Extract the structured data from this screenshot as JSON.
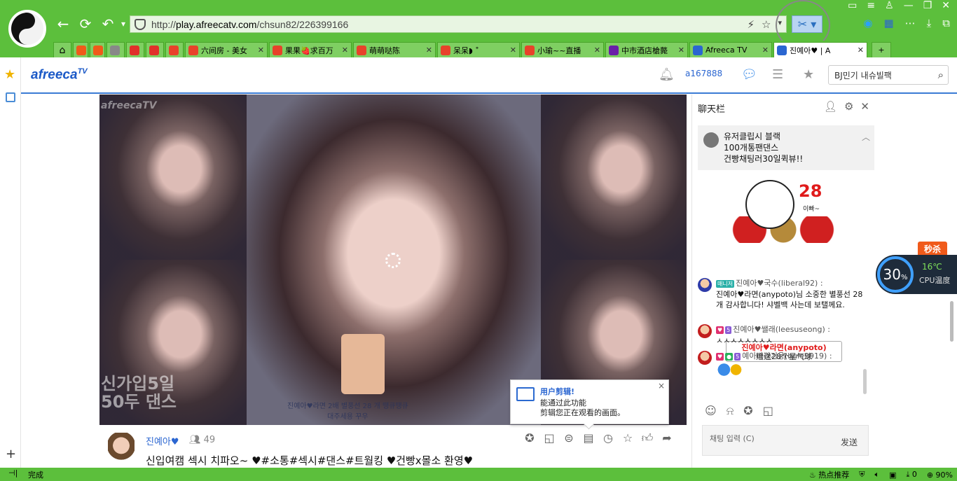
{
  "browser": {
    "url_prefix": "http://",
    "url_host": "play.afreecatv.com",
    "url_path": "/chsun82/226399166",
    "tabs": [
      {
        "label": "",
        "fav_color": "#f05a1a",
        "fav_icon": "taobao-icon"
      },
      {
        "label": "",
        "fav_color": "#f05a1a",
        "fav_icon": "taobao-icon"
      },
      {
        "label": "",
        "fav_color": "#888888",
        "fav_icon": "gear-icon"
      },
      {
        "label": "",
        "fav_color": "#e0302a",
        "fav_icon": "weibo-icon"
      },
      {
        "label": "",
        "fav_color": "#e0302a",
        "fav_icon": "weibo-icon"
      },
      {
        "label": "",
        "fav_color": "#e8422a",
        "fav_icon": "six-icon"
      },
      {
        "label": "六间房 - 美女",
        "fav_color": "#e8422a",
        "fav_icon": "six-icon"
      },
      {
        "label": "果果🍓求百万",
        "fav_color": "#e8422a",
        "fav_icon": "six-icon"
      },
      {
        "label": "萌萌哒陈",
        "fav_color": "#e8422a",
        "fav_icon": "six-icon"
      },
      {
        "label": "呆呆◗ ˚",
        "fav_color": "#e8422a",
        "fav_icon": "six-icon"
      },
      {
        "label": "小瑜~~直播",
        "fav_color": "#e8422a",
        "fav_icon": "six-icon"
      },
      {
        "label": "中市酒店槍斃",
        "fav_color": "#6a1fa8",
        "fav_icon": "yahoo-icon"
      },
      {
        "label": "Afreeca TV",
        "fav_color": "#2b66d1",
        "fav_icon": "afreeca-icon"
      },
      {
        "label": "진예아♥ | A",
        "fav_color": "#2b66d1",
        "fav_icon": "afreeca-icon",
        "active": true
      }
    ]
  },
  "header": {
    "brand": "afreeca",
    "brand_sup": "TV",
    "user_id": "a167888",
    "search_value": "BJ민기 내슈빌팩"
  },
  "video": {
    "logo": "afreecaTV",
    "overlay_line1": "신가입5일",
    "overlay_line2": "50두 댄스",
    "caption_line1": "진예아♥라면 2배 별풍선 28 개 땡큐땡큐",
    "caption_line2": "대주세용 꾸우"
  },
  "popup": {
    "title": "用户剪辑!",
    "line1": "能通过此功能",
    "line2": "剪辑您正在观看的画面。",
    "close": "×"
  },
  "broadcast": {
    "bj_name": "진예아♥",
    "viewers": "49",
    "title": "신입여캠 섹시 치파오~ ♥#소통#섹시#댄스#트월킹 ♥건빵x몰소 환영♥"
  },
  "chat": {
    "title": "聊天栏",
    "notice_lines": [
      "유저클립시 블랙",
      "100개통팬댄스",
      "건빵채팅러30일퀵뷰!!"
    ],
    "gift_count": "28",
    "gift_count_suffix": "이빠~",
    "gift_sender": "진예아♥라면(anypoto)",
    "gift_text": "赠送28个星气球",
    "messages": [
      {
        "badge": "매니저",
        "name": "진예아♥국수(liberal92) :",
        "text": "진예아♥라면(anypoto)님 소중한 별풍선 28개 감사합니다! 샤벨백 사는데 보탤께요.",
        "avatar": "blue"
      },
      {
        "badge": "",
        "name": "진예아♥쌜래(leesuseong) :",
        "text": "ㅅㅅㅅㅅㅅㅅㅅㅅ",
        "avatar": "red"
      },
      {
        "badge": "",
        "name": "예아바라기웅(bule9919) :",
        "text": "",
        "avatar": "red"
      }
    ],
    "input_placeholder": "채팅 입력 (C)",
    "send_label": "发送"
  },
  "widgets": {
    "miaosha": "秒杀",
    "cpu_percent": "30",
    "cpu_unit": "%",
    "cpu_temp": "16℃",
    "cpu_label": "CPU温度"
  },
  "status": {
    "left": "完成",
    "hot": "热点推荐",
    "count": "0",
    "zoom": "90%"
  }
}
